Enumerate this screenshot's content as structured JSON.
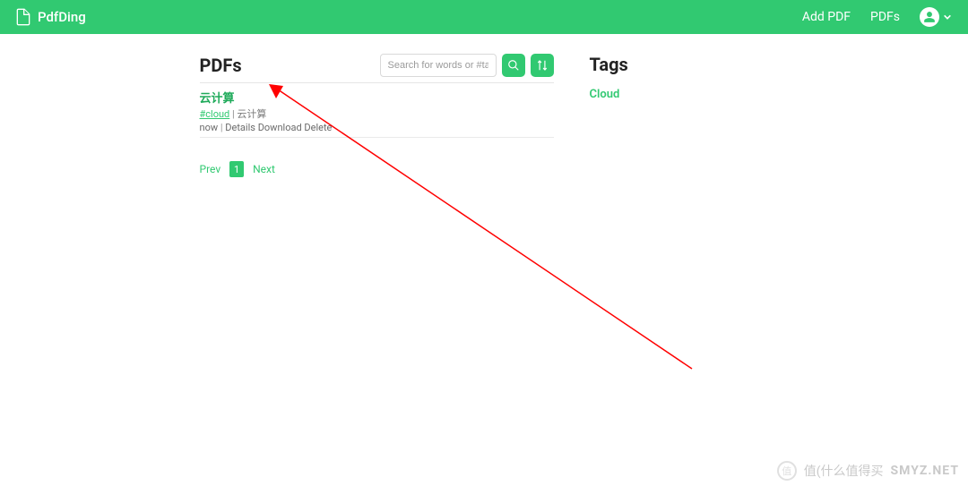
{
  "brand": {
    "name": "PdfDing"
  },
  "nav": {
    "add": "Add PDF",
    "pdfs": "PDFs"
  },
  "main": {
    "title": "PDFs",
    "search_placeholder": "Search for words or #tags",
    "items": [
      {
        "title": "云计算",
        "tag": "#cloud",
        "desc": "云计算",
        "time": "now",
        "actions": {
          "details": "Details",
          "download": "Download",
          "delete": "Delete"
        }
      }
    ],
    "pager": {
      "prev": "Prev",
      "current": "1",
      "next": "Next"
    }
  },
  "side": {
    "title": "Tags",
    "tags": [
      "Cloud"
    ]
  },
  "watermark": {
    "zh": "值(什么值得买",
    "en": "SMYZ.NET"
  }
}
